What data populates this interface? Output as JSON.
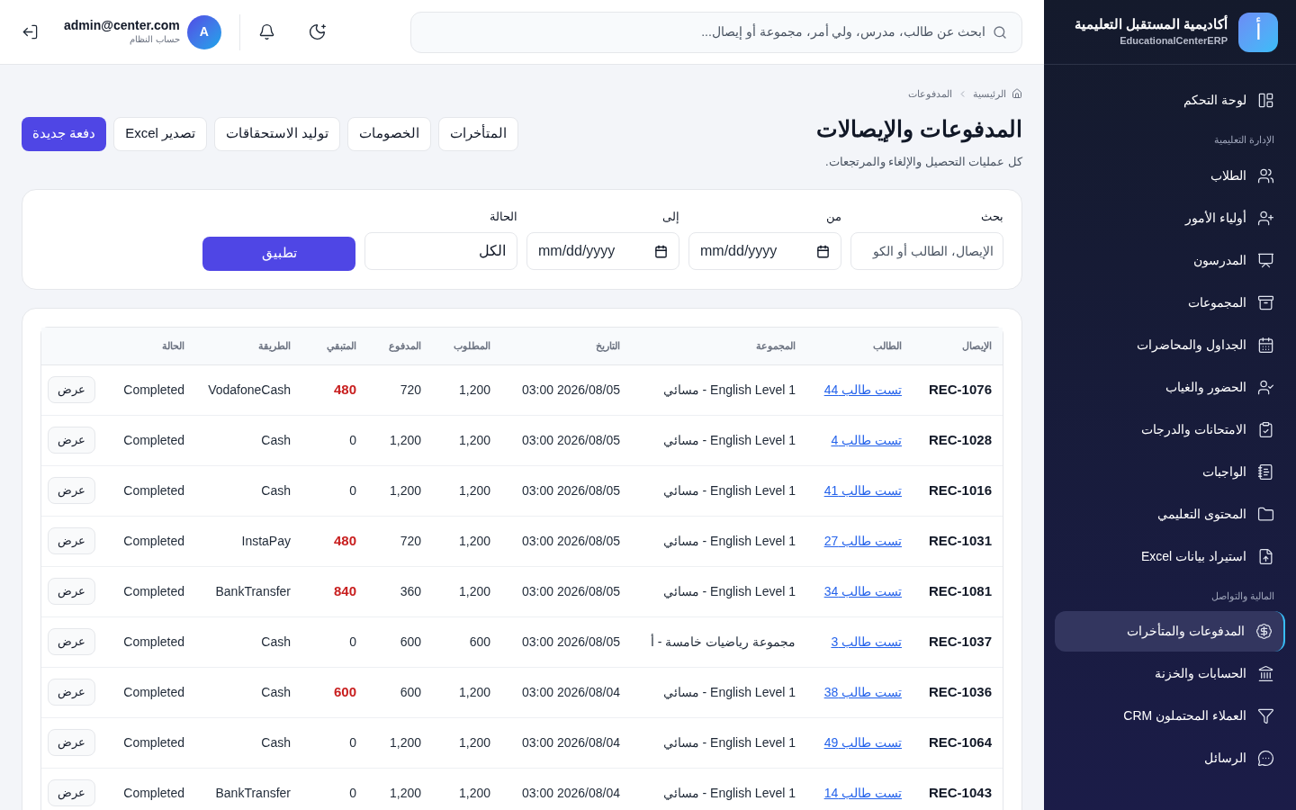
{
  "sidebar": {
    "brand": {
      "logo": "أ",
      "name": "أكاديمية المستقبل التعليمية",
      "subtitle": "EducationalCenterERP"
    },
    "items": [
      {
        "kind": "item",
        "label": "لوحة التحكم",
        "selected": false
      },
      {
        "kind": "section",
        "label": "الإدارة التعليمية"
      },
      {
        "kind": "item",
        "label": "الطلاب",
        "selected": false
      },
      {
        "kind": "item",
        "label": "أولياء الأمور",
        "selected": false
      },
      {
        "kind": "item",
        "label": "المدرسون",
        "selected": false
      },
      {
        "kind": "item",
        "label": "المجموعات",
        "selected": false
      },
      {
        "kind": "item",
        "label": "الجداول والمحاضرات",
        "selected": false
      },
      {
        "kind": "item",
        "label": "الحضور والغياب",
        "selected": false
      },
      {
        "kind": "item",
        "label": "الامتحانات والدرجات",
        "selected": false
      },
      {
        "kind": "item",
        "label": "الواجبات",
        "selected": false
      },
      {
        "kind": "item",
        "label": "المحتوى التعليمي",
        "selected": false
      },
      {
        "kind": "item",
        "label": "استيراد بيانات Excel",
        "selected": false
      },
      {
        "kind": "section",
        "label": "المالية والتواصل"
      },
      {
        "kind": "item",
        "label": "المدفوعات والمتأخرات",
        "selected": true
      },
      {
        "kind": "item",
        "label": "الحسابات والخزنة",
        "selected": false
      },
      {
        "kind": "item",
        "label": "العملاء المحتملون CRM",
        "selected": false
      },
      {
        "kind": "item",
        "label": "الرسائل",
        "selected": false
      }
    ]
  },
  "topbar": {
    "search": {
      "placeholder": "ابحث عن طالب، مدرس، ولي أمر، مجموعة أو إيصال..."
    },
    "user": {
      "avatar": "A",
      "email": "admin@center.com",
      "role": "حساب النظام"
    }
  },
  "breadcrumb": [
    "الرئيسية",
    "المدفوعات"
  ],
  "title": "المدفوعات والإيصالات",
  "subtitle": "كل عمليات التحصيل والإلغاء والمرتجعات.",
  "actions": [
    {
      "label": "المتأخرات",
      "kind": "secondary"
    },
    {
      "label": "الخصومات",
      "kind": "secondary"
    },
    {
      "label": "توليد الاستحقاقات",
      "kind": "secondary"
    },
    {
      "label": "تصدير Excel",
      "kind": "secondary"
    },
    {
      "label": "دفعة جديدة",
      "kind": "primary"
    }
  ],
  "filters": {
    "search": {
      "label": "بحث",
      "placeholder": "الإيصال، الطالب أو الكو"
    },
    "from": {
      "label": "من",
      "placeholder": "mm/dd/yyyy"
    },
    "to": {
      "label": "إلى",
      "placeholder": "mm/dd/yyyy"
    },
    "status": {
      "label": "الحالة",
      "value": "الكل"
    },
    "apply": "تطبيق"
  },
  "table": {
    "columns": [
      "الإيصال",
      "الطالب",
      "المجموعة",
      "التاريخ",
      "المطلوب",
      "المدفوع",
      "المتبقي",
      "الطريقة",
      "الحالة"
    ],
    "rows": [
      {
        "receipt": "REC-1076",
        "student": "تست طالب 44",
        "group": "English Level 1 - مسائي",
        "date": "2026/08/05 03:00",
        "required": "1,200",
        "paid": "720",
        "remaining": "480",
        "overdue": true,
        "method": "VodafoneCash",
        "status": "Completed",
        "action": "عرض"
      },
      {
        "receipt": "REC-1028",
        "student": "تست طالب 4",
        "group": "English Level 1 - مسائي",
        "date": "2026/08/05 03:00",
        "required": "1,200",
        "paid": "1,200",
        "remaining": "0",
        "overdue": false,
        "method": "Cash",
        "status": "Completed",
        "action": "عرض"
      },
      {
        "receipt": "REC-1016",
        "student": "تست طالب 41",
        "group": "English Level 1 - مسائي",
        "date": "2026/08/05 03:00",
        "required": "1,200",
        "paid": "1,200",
        "remaining": "0",
        "overdue": false,
        "method": "Cash",
        "status": "Completed",
        "action": "عرض"
      },
      {
        "receipt": "REC-1031",
        "student": "تست طالب 27",
        "group": "English Level 1 - مسائي",
        "date": "2026/08/05 03:00",
        "required": "1,200",
        "paid": "720",
        "remaining": "480",
        "overdue": true,
        "method": "InstaPay",
        "status": "Completed",
        "action": "عرض"
      },
      {
        "receipt": "REC-1081",
        "student": "تست طالب 34",
        "group": "English Level 1 - مسائي",
        "date": "2026/08/05 03:00",
        "required": "1,200",
        "paid": "360",
        "remaining": "840",
        "overdue": true,
        "method": "BankTransfer",
        "status": "Completed",
        "action": "عرض"
      },
      {
        "receipt": "REC-1037",
        "student": "تست طالب 3",
        "group": "مجموعة رياضيات خامسة - أ",
        "date": "2026/08/05 03:00",
        "required": "600",
        "paid": "600",
        "remaining": "0",
        "overdue": false,
        "method": "Cash",
        "status": "Completed",
        "action": "عرض"
      },
      {
        "receipt": "REC-1036",
        "student": "تست طالب 38",
        "group": "English Level 1 - مسائي",
        "date": "2026/08/04 03:00",
        "required": "1,200",
        "paid": "600",
        "remaining": "600",
        "overdue": true,
        "method": "Cash",
        "status": "Completed",
        "action": "عرض"
      },
      {
        "receipt": "REC-1064",
        "student": "تست طالب 49",
        "group": "English Level 1 - مسائي",
        "date": "2026/08/04 03:00",
        "required": "1,200",
        "paid": "1,200",
        "remaining": "0",
        "overdue": false,
        "method": "Cash",
        "status": "Completed",
        "action": "عرض"
      },
      {
        "receipt": "REC-1043",
        "student": "تست طالب 14",
        "group": "English Level 1 - مسائي",
        "date": "2026/08/04 03:00",
        "required": "1,200",
        "paid": "1,200",
        "remaining": "0",
        "overdue": false,
        "method": "BankTransfer",
        "status": "Completed",
        "action": "عرض"
      }
    ]
  }
}
